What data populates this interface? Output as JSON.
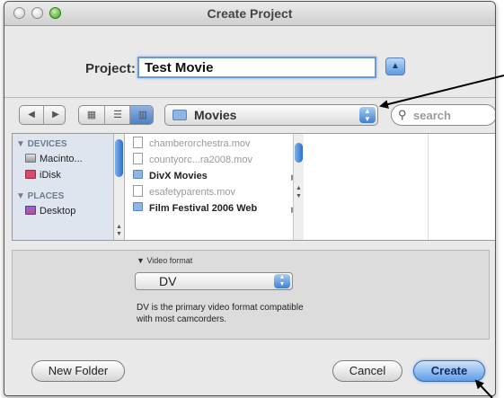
{
  "window": {
    "title": "Create Project"
  },
  "project": {
    "label": "Project:",
    "value": "Test Movie"
  },
  "toolbar": {
    "location": "Movies",
    "search_placeholder": "search"
  },
  "sidebar": {
    "sections": [
      {
        "heading": "▼ DEVICES",
        "items": [
          "Macinto...",
          "iDisk"
        ]
      },
      {
        "heading": "▼ PLACES",
        "items": [
          "Desktop"
        ]
      }
    ]
  },
  "files": [
    {
      "name": "chamberorchestra.mov",
      "kind": "file",
      "enabled": false
    },
    {
      "name": "countyorc...ra2008.mov",
      "kind": "file",
      "enabled": false
    },
    {
      "name": "DivX Movies",
      "kind": "folder",
      "enabled": true
    },
    {
      "name": "esafetyparents.mov",
      "kind": "file",
      "enabled": false
    },
    {
      "name": "Film Festival 2006 Web",
      "kind": "folder",
      "enabled": true
    }
  ],
  "video_format": {
    "label": "Video format",
    "selected": "DV",
    "description_line1": "DV is the primary video format compatible",
    "description_line2": "with most camcorders."
  },
  "buttons": {
    "new_folder": "New Folder",
    "cancel": "Cancel",
    "create": "Create"
  }
}
